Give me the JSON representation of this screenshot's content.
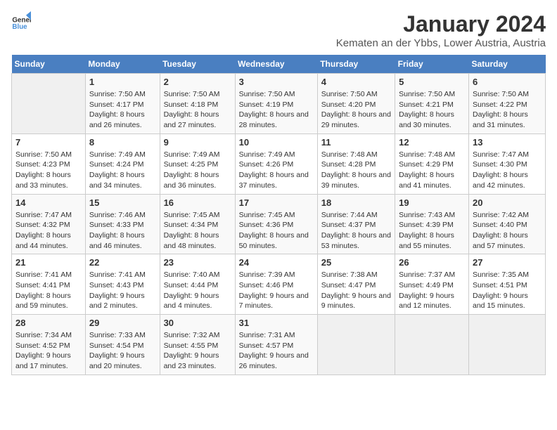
{
  "logo": {
    "general": "General",
    "blue": "Blue"
  },
  "title": "January 2024",
  "subtitle": "Kematen an der Ybbs, Lower Austria, Austria",
  "days_header": [
    "Sunday",
    "Monday",
    "Tuesday",
    "Wednesday",
    "Thursday",
    "Friday",
    "Saturday"
  ],
  "weeks": [
    [
      {
        "day": "",
        "sunrise": "",
        "sunset": "",
        "daylight": ""
      },
      {
        "day": "1",
        "sunrise": "Sunrise: 7:50 AM",
        "sunset": "Sunset: 4:17 PM",
        "daylight": "Daylight: 8 hours and 26 minutes."
      },
      {
        "day": "2",
        "sunrise": "Sunrise: 7:50 AM",
        "sunset": "Sunset: 4:18 PM",
        "daylight": "Daylight: 8 hours and 27 minutes."
      },
      {
        "day": "3",
        "sunrise": "Sunrise: 7:50 AM",
        "sunset": "Sunset: 4:19 PM",
        "daylight": "Daylight: 8 hours and 28 minutes."
      },
      {
        "day": "4",
        "sunrise": "Sunrise: 7:50 AM",
        "sunset": "Sunset: 4:20 PM",
        "daylight": "Daylight: 8 hours and 29 minutes."
      },
      {
        "day": "5",
        "sunrise": "Sunrise: 7:50 AM",
        "sunset": "Sunset: 4:21 PM",
        "daylight": "Daylight: 8 hours and 30 minutes."
      },
      {
        "day": "6",
        "sunrise": "Sunrise: 7:50 AM",
        "sunset": "Sunset: 4:22 PM",
        "daylight": "Daylight: 8 hours and 31 minutes."
      }
    ],
    [
      {
        "day": "7",
        "sunrise": "Sunrise: 7:50 AM",
        "sunset": "Sunset: 4:23 PM",
        "daylight": "Daylight: 8 hours and 33 minutes."
      },
      {
        "day": "8",
        "sunrise": "Sunrise: 7:49 AM",
        "sunset": "Sunset: 4:24 PM",
        "daylight": "Daylight: 8 hours and 34 minutes."
      },
      {
        "day": "9",
        "sunrise": "Sunrise: 7:49 AM",
        "sunset": "Sunset: 4:25 PM",
        "daylight": "Daylight: 8 hours and 36 minutes."
      },
      {
        "day": "10",
        "sunrise": "Sunrise: 7:49 AM",
        "sunset": "Sunset: 4:26 PM",
        "daylight": "Daylight: 8 hours and 37 minutes."
      },
      {
        "day": "11",
        "sunrise": "Sunrise: 7:48 AM",
        "sunset": "Sunset: 4:28 PM",
        "daylight": "Daylight: 8 hours and 39 minutes."
      },
      {
        "day": "12",
        "sunrise": "Sunrise: 7:48 AM",
        "sunset": "Sunset: 4:29 PM",
        "daylight": "Daylight: 8 hours and 41 minutes."
      },
      {
        "day": "13",
        "sunrise": "Sunrise: 7:47 AM",
        "sunset": "Sunset: 4:30 PM",
        "daylight": "Daylight: 8 hours and 42 minutes."
      }
    ],
    [
      {
        "day": "14",
        "sunrise": "Sunrise: 7:47 AM",
        "sunset": "Sunset: 4:32 PM",
        "daylight": "Daylight: 8 hours and 44 minutes."
      },
      {
        "day": "15",
        "sunrise": "Sunrise: 7:46 AM",
        "sunset": "Sunset: 4:33 PM",
        "daylight": "Daylight: 8 hours and 46 minutes."
      },
      {
        "day": "16",
        "sunrise": "Sunrise: 7:45 AM",
        "sunset": "Sunset: 4:34 PM",
        "daylight": "Daylight: 8 hours and 48 minutes."
      },
      {
        "day": "17",
        "sunrise": "Sunrise: 7:45 AM",
        "sunset": "Sunset: 4:36 PM",
        "daylight": "Daylight: 8 hours and 50 minutes."
      },
      {
        "day": "18",
        "sunrise": "Sunrise: 7:44 AM",
        "sunset": "Sunset: 4:37 PM",
        "daylight": "Daylight: 8 hours and 53 minutes."
      },
      {
        "day": "19",
        "sunrise": "Sunrise: 7:43 AM",
        "sunset": "Sunset: 4:39 PM",
        "daylight": "Daylight: 8 hours and 55 minutes."
      },
      {
        "day": "20",
        "sunrise": "Sunrise: 7:42 AM",
        "sunset": "Sunset: 4:40 PM",
        "daylight": "Daylight: 8 hours and 57 minutes."
      }
    ],
    [
      {
        "day": "21",
        "sunrise": "Sunrise: 7:41 AM",
        "sunset": "Sunset: 4:41 PM",
        "daylight": "Daylight: 8 hours and 59 minutes."
      },
      {
        "day": "22",
        "sunrise": "Sunrise: 7:41 AM",
        "sunset": "Sunset: 4:43 PM",
        "daylight": "Daylight: 9 hours and 2 minutes."
      },
      {
        "day": "23",
        "sunrise": "Sunrise: 7:40 AM",
        "sunset": "Sunset: 4:44 PM",
        "daylight": "Daylight: 9 hours and 4 minutes."
      },
      {
        "day": "24",
        "sunrise": "Sunrise: 7:39 AM",
        "sunset": "Sunset: 4:46 PM",
        "daylight": "Daylight: 9 hours and 7 minutes."
      },
      {
        "day": "25",
        "sunrise": "Sunrise: 7:38 AM",
        "sunset": "Sunset: 4:47 PM",
        "daylight": "Daylight: 9 hours and 9 minutes."
      },
      {
        "day": "26",
        "sunrise": "Sunrise: 7:37 AM",
        "sunset": "Sunset: 4:49 PM",
        "daylight": "Daylight: 9 hours and 12 minutes."
      },
      {
        "day": "27",
        "sunrise": "Sunrise: 7:35 AM",
        "sunset": "Sunset: 4:51 PM",
        "daylight": "Daylight: 9 hours and 15 minutes."
      }
    ],
    [
      {
        "day": "28",
        "sunrise": "Sunrise: 7:34 AM",
        "sunset": "Sunset: 4:52 PM",
        "daylight": "Daylight: 9 hours and 17 minutes."
      },
      {
        "day": "29",
        "sunrise": "Sunrise: 7:33 AM",
        "sunset": "Sunset: 4:54 PM",
        "daylight": "Daylight: 9 hours and 20 minutes."
      },
      {
        "day": "30",
        "sunrise": "Sunrise: 7:32 AM",
        "sunset": "Sunset: 4:55 PM",
        "daylight": "Daylight: 9 hours and 23 minutes."
      },
      {
        "day": "31",
        "sunrise": "Sunrise: 7:31 AM",
        "sunset": "Sunset: 4:57 PM",
        "daylight": "Daylight: 9 hours and 26 minutes."
      },
      {
        "day": "",
        "sunrise": "",
        "sunset": "",
        "daylight": ""
      },
      {
        "day": "",
        "sunrise": "",
        "sunset": "",
        "daylight": ""
      },
      {
        "day": "",
        "sunrise": "",
        "sunset": "",
        "daylight": ""
      }
    ]
  ]
}
